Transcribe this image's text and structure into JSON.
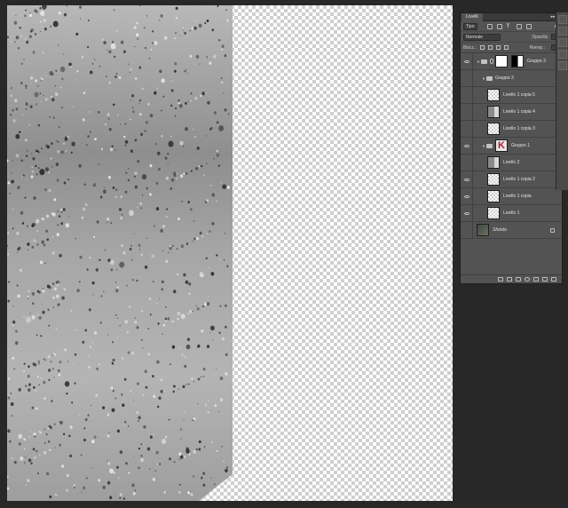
{
  "panel": {
    "tab_label": "Livelli",
    "menu_glyph": "▸▸ ≡",
    "filter_kind": "Tipo",
    "blend_mode": "Normale",
    "opacity_label": "Opacità:",
    "lock_label": "Blocc.:",
    "fill_label": "Riemp.:"
  },
  "layers": [
    {
      "name": "Gruppo 3",
      "visible": true,
      "kind": "group",
      "expanded": true,
      "indent": 0,
      "thumb": "black",
      "mask": true
    },
    {
      "name": "Gruppo 2",
      "visible": false,
      "kind": "group",
      "expanded": true,
      "indent": 1,
      "thumb": "none"
    },
    {
      "name": "Livello 1 copia 5",
      "visible": false,
      "kind": "layer",
      "indent": 2,
      "thumb": "checker"
    },
    {
      "name": "Livello 1 copia 4",
      "visible": false,
      "kind": "layer",
      "indent": 2,
      "thumb": "gray"
    },
    {
      "name": "Livello 1 copia 3",
      "visible": false,
      "kind": "layer",
      "indent": 2,
      "thumb": "checker"
    },
    {
      "name": "Gruppo 1",
      "visible": true,
      "kind": "group",
      "expanded": true,
      "indent": 1,
      "thumb": "k"
    },
    {
      "name": "Livello 2",
      "visible": false,
      "kind": "layer",
      "indent": 2,
      "thumb": "gray"
    },
    {
      "name": "Livello 1 copia 2",
      "visible": true,
      "kind": "layer",
      "indent": 2,
      "thumb": "checker"
    },
    {
      "name": "Livello 1 copia",
      "visible": true,
      "kind": "layer",
      "indent": 2,
      "thumb": "checker"
    },
    {
      "name": "Livello 1",
      "visible": true,
      "kind": "layer",
      "indent": 2,
      "thumb": "checker"
    },
    {
      "name": "Sfondo",
      "visible": false,
      "kind": "background",
      "indent": 0,
      "thumb": "dark",
      "locked": true
    }
  ],
  "colors": {
    "workspace": "#282828",
    "panel": "#535353",
    "accent_red": "#b3182f"
  }
}
